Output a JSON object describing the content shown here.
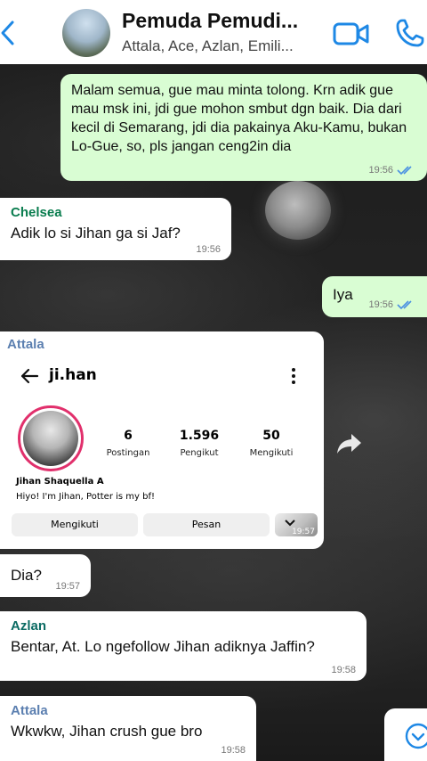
{
  "header": {
    "title": "Pemuda Pemudi...",
    "members": "Attala, Ace, Azlan, Emili..."
  },
  "messages": [
    {
      "text": "Malam semua, gue mau minta tolong. Krn adik gue mau msk ini, jdi gue mohon smbut dgn baik. Dia dari kecil di Semarang, jdi dia pakainya Aku-Kamu, bukan Lo-Gue, so, pls jangan ceng2in dia",
      "time": "19:56"
    },
    {
      "sender": "Chelsea",
      "text": "Adik lo si Jihan ga si Jaf?",
      "time": "19:56"
    },
    {
      "text": "Iya",
      "time": "19:56"
    },
    {
      "sender": "Attala"
    },
    {
      "text": "Dia?",
      "time": "19:57"
    },
    {
      "sender": "Azlan",
      "text": "Bentar, At. Lo ngefollow Jihan adiknya Jaffin?",
      "time": "19:58"
    },
    {
      "sender": "Attala",
      "text": "Wkwkw, Jihan crush gue bro",
      "time": "19:58"
    }
  ],
  "profile_card": {
    "username": "ji.han",
    "posts_count": "6",
    "posts_label": "Postingan",
    "followers_count": "1.596",
    "followers_label": "Pengikut",
    "following_count": "50",
    "following_label": "Mengikuti",
    "name": "Jihan Shaquella A",
    "bio": "Hiyo! I'm Jihan, Potter is my bf!",
    "follow_button": "Mengikuti",
    "message_button": "Pesan",
    "time": "19:57"
  },
  "colors": {
    "outgoing_bubble": "#d9fdd3",
    "incoming_bubble": "#ffffff",
    "sender_chelsea": "#0a7d4f",
    "sender_attala": "#5b7fb0",
    "sender_azlan": "#0b6b63",
    "accent_blue": "#1e88e5"
  }
}
